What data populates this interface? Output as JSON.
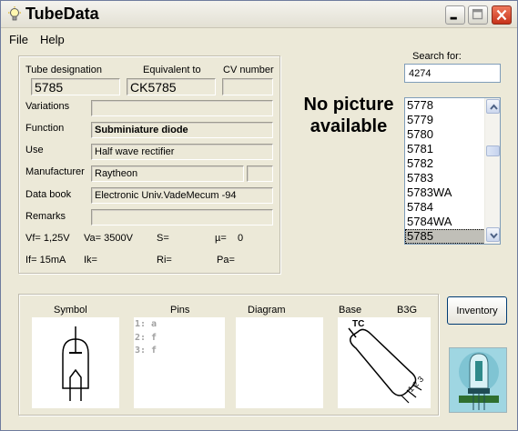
{
  "window": {
    "title": "TubeData"
  },
  "menu": {
    "file": "File",
    "help": "Help"
  },
  "form": {
    "tube_designation_label": "Tube designation",
    "tube_designation": "5785",
    "equivalent_label": "Equivalent to",
    "equivalent": "CK5785",
    "cv_label": "CV number",
    "cv": "",
    "variations_label": "Variations",
    "variations": "",
    "function_label": "Function",
    "function": "Subminiature diode",
    "use_label": "Use",
    "use": "Half wave rectifier",
    "manufacturer_label": "Manufacturer",
    "manufacturer": "Raytheon",
    "databook_label": "Data book",
    "databook": "Electronic Univ.VadeMecum -94",
    "remarks_label": "Remarks",
    "remarks": ""
  },
  "params": {
    "vf": "Vf= 1,25V",
    "va": "Va= 3500V",
    "s": "S=",
    "mu": "µ=",
    "mu_val": "0",
    "if": "If= 15mA",
    "ik": "Ik=",
    "ri": "Ri=",
    "pa": "Pa="
  },
  "picture": {
    "message": "No picture available"
  },
  "search": {
    "label": "Search for:",
    "value": "4274"
  },
  "list": {
    "items": [
      "5778",
      "5779",
      "5780",
      "5781",
      "5782",
      "5783",
      "5783WA",
      "5784",
      "5784WA",
      "5785"
    ],
    "selected": "5785"
  },
  "bottom": {
    "symbol_label": "Symbol",
    "pins_label": "Pins",
    "diagram_label": "Diagram",
    "base_label": "Base",
    "base_type": "B3G",
    "pins": [
      "1: a",
      "2: f",
      "3: f"
    ],
    "base_letters": "TC",
    "base_numbers": "1 2 3"
  },
  "inventory_button": "Inventory",
  "icons": [
    "app-icon",
    "minimize-icon",
    "maximize-icon",
    "close-icon",
    "scroll-up-icon",
    "scroll-down-icon"
  ],
  "colors": {
    "window_bg": "#ece9d8",
    "close_button": "#c6321a",
    "list_selection": "#c0bfb8"
  }
}
